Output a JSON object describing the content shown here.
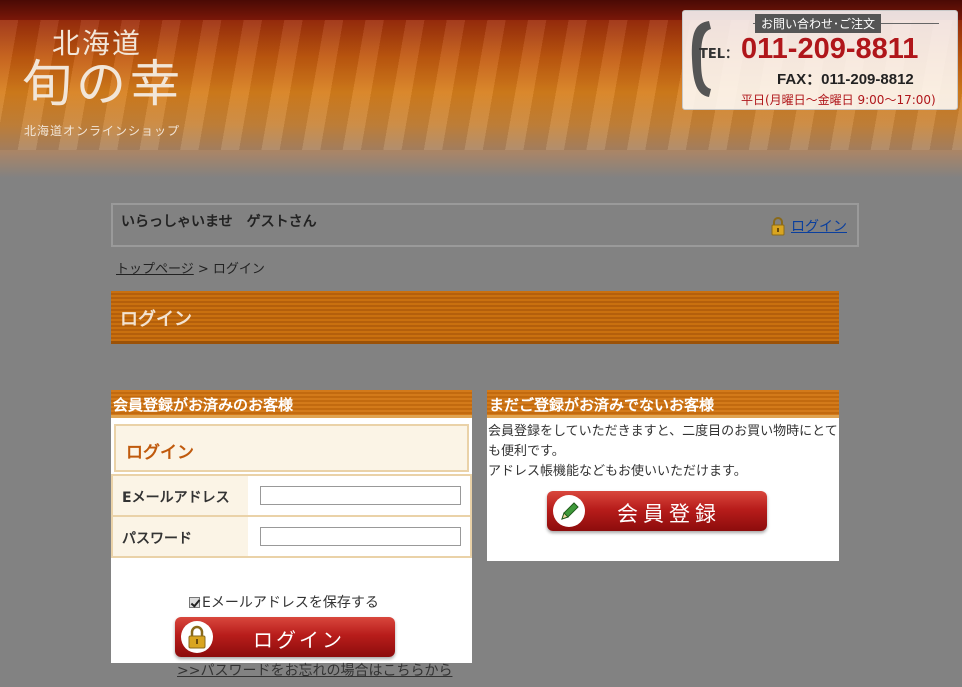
{
  "header": {
    "logo_top": "北海道",
    "logo_main": "旬の幸",
    "logo_sub": "北海道オンラインショップ",
    "contact": {
      "inquiry_label": "お問い合わせ･ご注文",
      "tel_label": "TEL：",
      "tel_number": "011-209-8811",
      "fax": "FAX：011-209-8812",
      "hours": "平日(月曜日～金曜日 9:00～17:00)"
    }
  },
  "welcome": {
    "greeting": "いらっしゃいませ　ゲストさん",
    "login_link": "ログイン"
  },
  "breadcrumb": {
    "home": "トップページ",
    "separator": " > ",
    "current": "ログイン"
  },
  "page_title": "ログイン",
  "member_panel": {
    "heading": "会員登録がお済みのお客様",
    "inner_title": "ログイン",
    "email_label": "Eメールアドレス",
    "email_value": "",
    "password_label": "パスワード",
    "password_value": "",
    "save_email_label": "Eメールアドレスを保存する",
    "save_email_checked": true,
    "login_button": "ログイン",
    "forgot_link": ">>パスワードをお忘れの場合はこちらから"
  },
  "guest_panel": {
    "heading": "まだご登録がお済みでないお客様",
    "line1": "会員登録をしていただきますと、二度目のお買い物時にとても便利です。",
    "line2": "アドレス帳機能などもお使いいただけます。",
    "register_button": "会員登録"
  },
  "colors": {
    "accent_orange": "#c9700f",
    "button_red": "#b81d1b",
    "link_blue": "#0a3f9e",
    "phone_red": "#b0161a"
  },
  "icons": [
    "phone-icon",
    "lock-icon",
    "pencil-icon"
  ]
}
